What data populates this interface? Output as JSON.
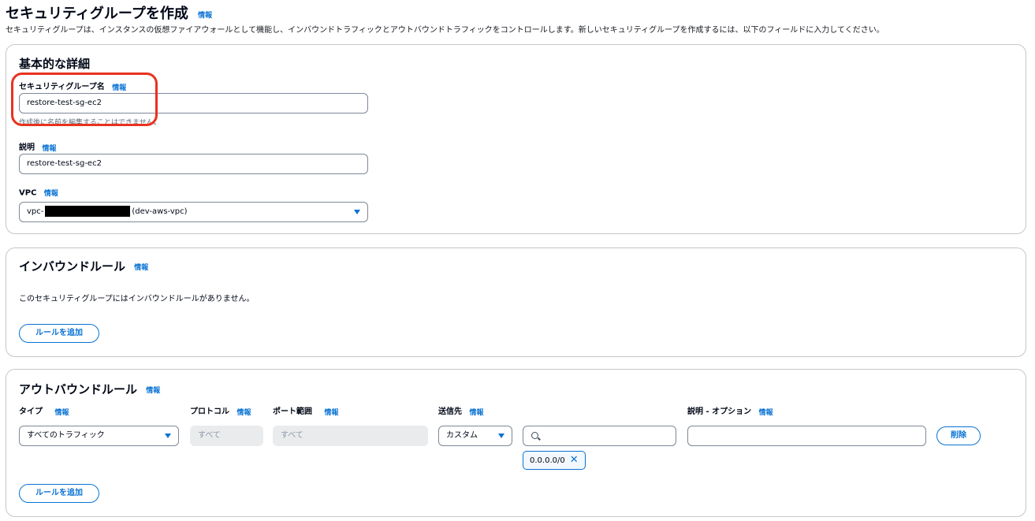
{
  "header": {
    "title": "セキュリティグループを作成",
    "info": "情報",
    "description": "セキュリティグループは、インスタンスの仮想ファイアウォールとして機能し、インバウンドトラフィックとアウトバウンドトラフィックをコントロールします。新しいセキュリティグループを作成するには、以下のフィールドに入力してください。"
  },
  "basic": {
    "title": "基本的な詳細",
    "name_label": "セキュリティグループ名",
    "name_info": "情報",
    "name_value": "restore-test-sg-ec2",
    "name_hint": "作成後に名前を編集することはできません。",
    "desc_label": "説明",
    "desc_info": "情報",
    "desc_value": "restore-test-sg-ec2",
    "vpc_label": "VPC",
    "vpc_info": "情報",
    "vpc_prefix": "vpc-",
    "vpc_suffix": "(dev-aws-vpc)"
  },
  "inbound": {
    "title": "インバウンドルール",
    "info": "情報",
    "empty_text": "このセキュリティグループにはインバウンドルールがありません。",
    "add_button": "ルールを追加"
  },
  "outbound": {
    "title": "アウトバウンドルール",
    "info": "情報",
    "columns": {
      "type": "タイプ",
      "type_info": "情報",
      "protocol": "プロトコル",
      "protocol_info": "情報",
      "port": "ポート範囲",
      "port_info": "情報",
      "destination": "送信先",
      "destination_info": "情報",
      "description": "説明 - オプション",
      "description_info": "情報"
    },
    "rule": {
      "type": "すべてのトラフィック",
      "protocol": "すべて",
      "port": "すべて",
      "destination_type": "カスタム",
      "cidr_token": "0.0.0.0/0",
      "delete_button": "削除"
    },
    "add_button": "ルールを追加"
  },
  "colors": {
    "accent": "#0972d3",
    "highlight": "#e8321f"
  }
}
